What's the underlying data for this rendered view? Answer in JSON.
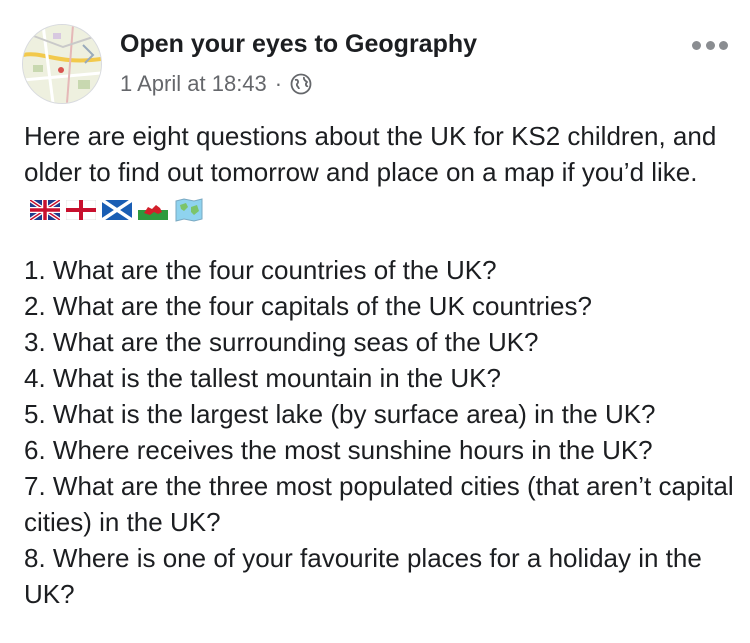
{
  "post": {
    "author": "Open your eyes to Geography",
    "timestamp": "1 April at 18:43",
    "separator": "·",
    "privacy_icon": "globe-icon",
    "more_icon": "more-options-icon",
    "intro_text": "Here are eight questions about the UK for KS2 children, and older to find out tomorrow and place on a map if you’d like.",
    "emojis": [
      "uk-flag-icon",
      "england-flag-icon",
      "scotland-flag-icon",
      "wales-flag-icon",
      "world-map-icon"
    ],
    "questions": [
      "1. What are the four countries of the UK?",
      "2. What are the four capitals of the UK countries?",
      "3. What are the surrounding seas of the UK?",
      "4. What is the tallest mountain in the UK?",
      "5. What is the largest lake (by surface area) in the UK?",
      "6. Where receives the most sunshine hours in the UK?",
      "7. What are the three most populated cities (that aren’t capital cities) in the UK?",
      "8. Where is one of your favourite places for a holiday in the UK?"
    ]
  },
  "colors": {
    "text": "#1c1e21",
    "secondary_text": "#65676b",
    "icon_gray": "#8a8d91"
  }
}
